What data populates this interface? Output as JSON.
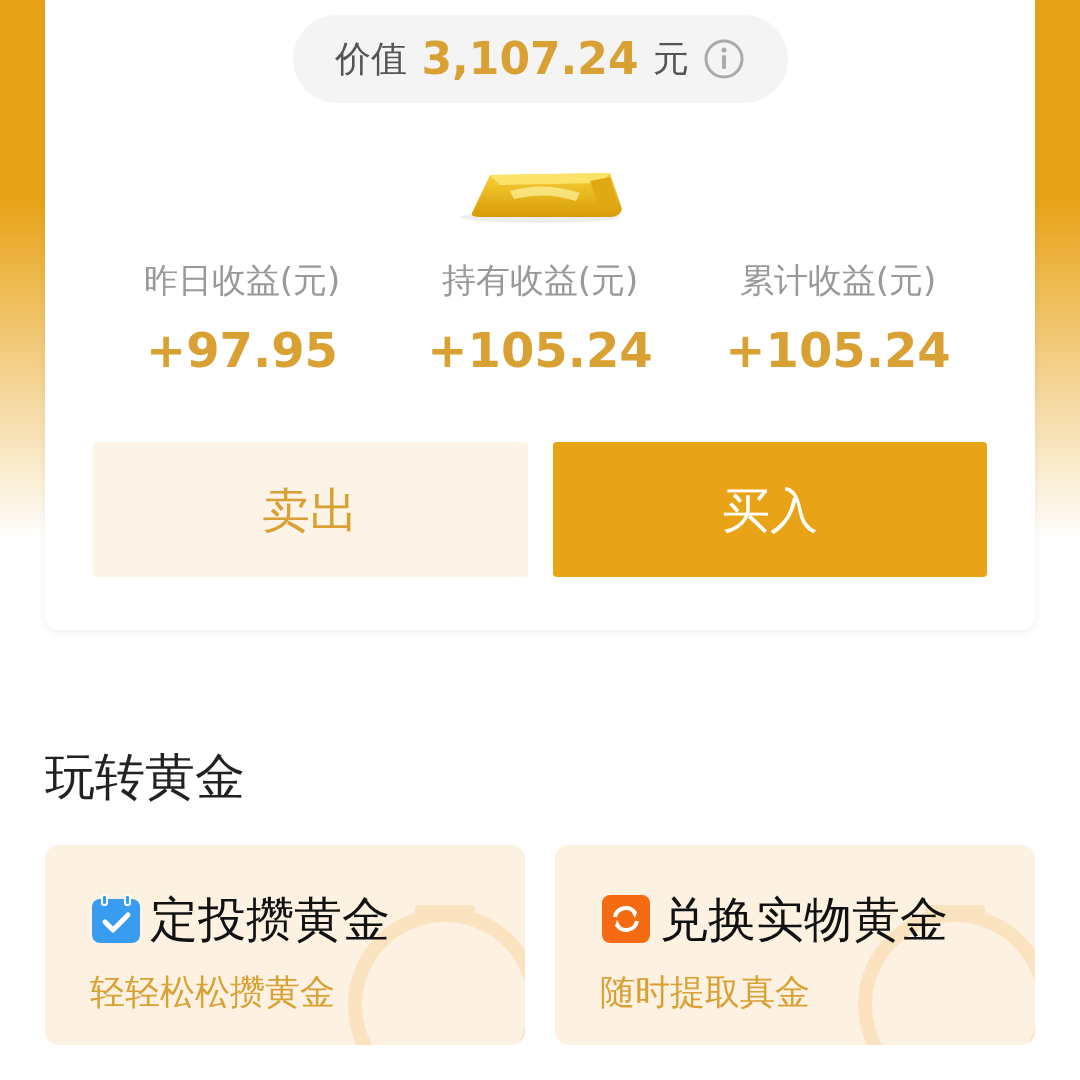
{
  "value_pill": {
    "label": "价值",
    "amount": "3,107.24",
    "unit": "元"
  },
  "stats": [
    {
      "label": "昨日收益(元)",
      "value": "+97.95"
    },
    {
      "label": "持有收益(元)",
      "value": "+105.24"
    },
    {
      "label": "累计收益(元)",
      "value": "+105.24"
    }
  ],
  "buttons": [
    {
      "label": "卖出",
      "kind": "secondary"
    },
    {
      "label": "买入",
      "kind": "primary"
    }
  ],
  "section": {
    "title": "玩转黄金",
    "cards": [
      {
        "kind": "calendar",
        "title": "定投攒黄金",
        "subtitle": "轻轻松松攒黄金"
      },
      {
        "kind": "exchange",
        "title": "兑换实物黄金",
        "subtitle": "随时提取真金"
      }
    ]
  }
}
